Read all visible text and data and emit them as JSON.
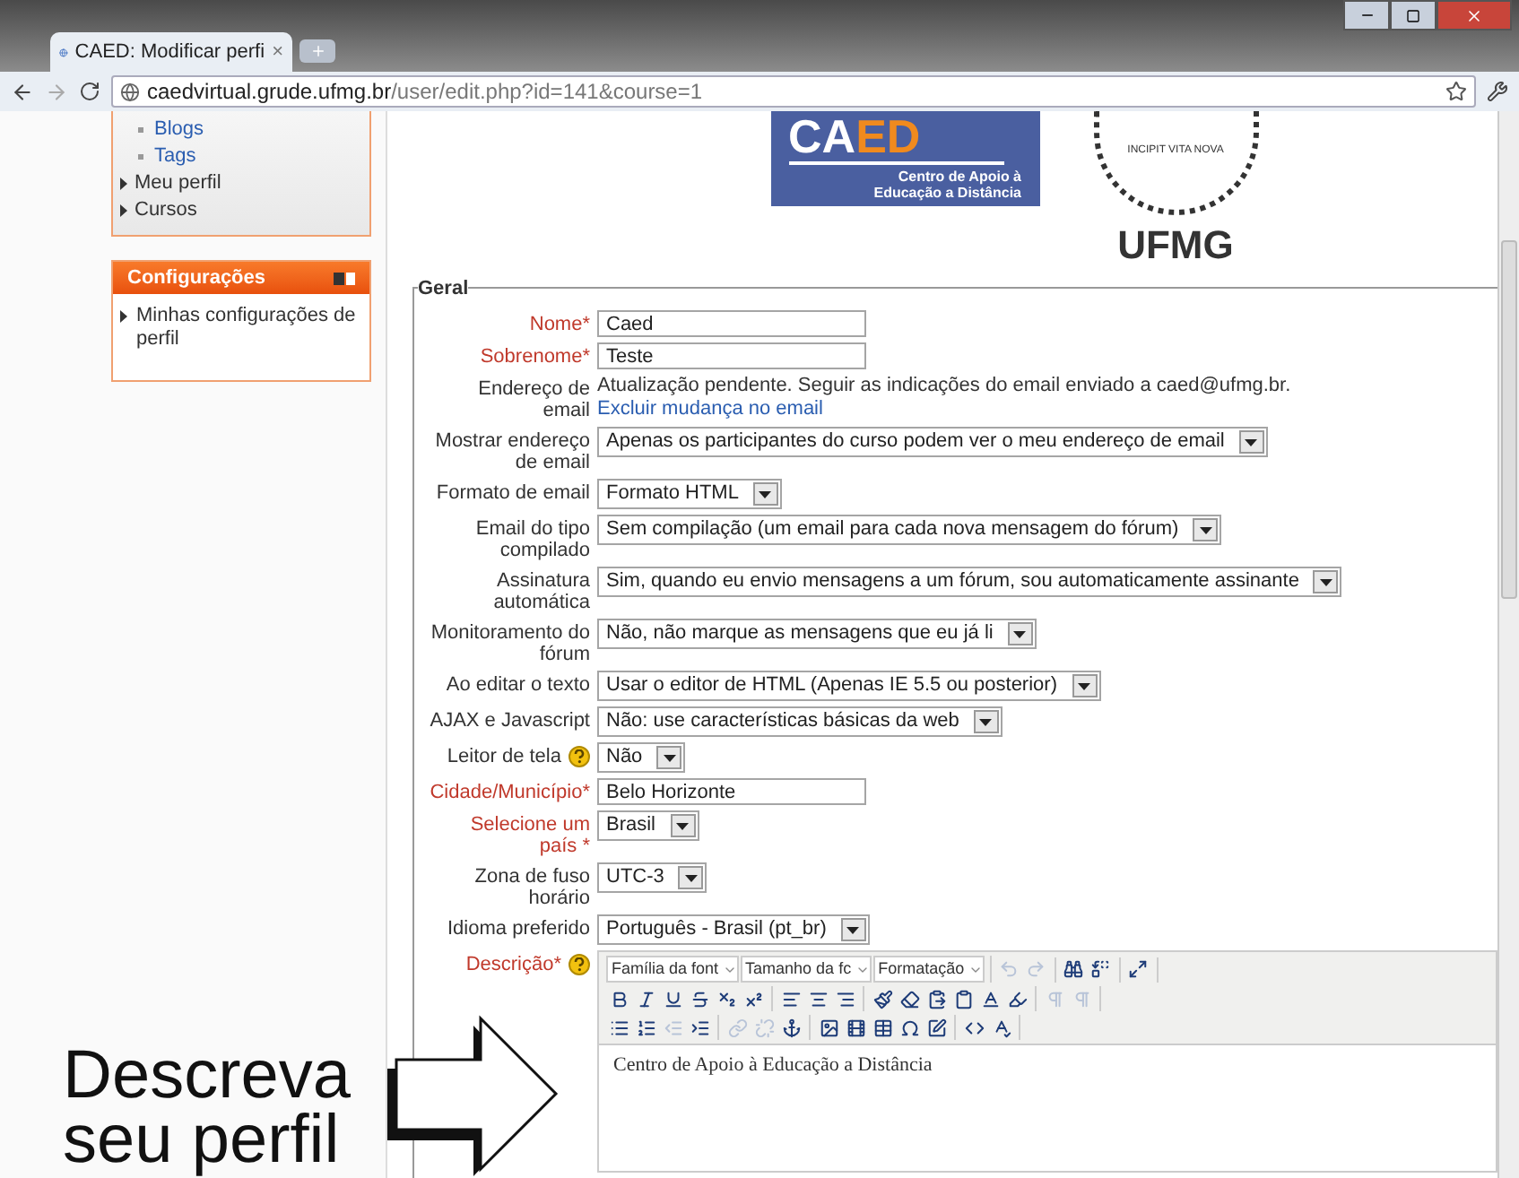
{
  "browser": {
    "tab_title": "CAED: Modificar perfi",
    "tab_close": "×",
    "address_host": "caedvirtual.grude.ufmg.br",
    "address_path": "/user/edit.php?id=141&course=1"
  },
  "sidebar": {
    "nav_items": [
      {
        "label": "Blogs",
        "kind": "sub"
      },
      {
        "label": "Tags",
        "kind": "sub"
      },
      {
        "label": "Meu perfil",
        "kind": "branch"
      },
      {
        "label": "Cursos",
        "kind": "branch"
      }
    ],
    "settings_block": {
      "title": "Configurações",
      "items": [
        "Minhas configurações de perfil"
      ]
    }
  },
  "header": {
    "caed": {
      "acronym_start": "CA",
      "acronym_end": "ED",
      "subtitle": [
        "Centro de Apoio à",
        "Educação a Distância"
      ]
    },
    "ufmg": {
      "motto": "INCIPIT VITA NOVA",
      "name": "UFMG"
    }
  },
  "form": {
    "legend": "Geral",
    "fields": [
      {
        "kind": "text",
        "label": "Nome*",
        "required": true,
        "help": false,
        "value": "Caed"
      },
      {
        "kind": "text",
        "label": "Sobrenome*",
        "required": true,
        "help": false,
        "value": "Teste"
      },
      {
        "kind": "static",
        "label": "Endereço de email",
        "required": false,
        "help": false,
        "value": "Atualização pendente. Seguir as indicações do email enviado a caed@ufmg.br.",
        "link": "Excluir mudança no email"
      },
      {
        "kind": "select",
        "label": "Mostrar endereço de email",
        "required": false,
        "help": false,
        "value": "Apenas os participantes do curso podem ver o meu endereço de email"
      },
      {
        "kind": "select",
        "label": "Formato de email",
        "required": false,
        "help": false,
        "value": "Formato HTML"
      },
      {
        "kind": "select",
        "label": "Email do tipo compilado",
        "required": false,
        "help": false,
        "value": "Sem compilação (um email para cada nova mensagem do fórum)"
      },
      {
        "kind": "select",
        "label": "Assinatura automática",
        "required": false,
        "help": false,
        "value": "Sim, quando eu envio mensagens a um fórum, sou automaticamente assinante"
      },
      {
        "kind": "select",
        "label": "Monitoramento do fórum",
        "required": false,
        "help": false,
        "value": "Não, não marque as mensagens que eu já li"
      },
      {
        "kind": "select",
        "label": "Ao editar o texto",
        "required": false,
        "help": false,
        "value": "Usar o editor de HTML (Apenas IE 5.5 ou posterior)"
      },
      {
        "kind": "select",
        "label": "AJAX e Javascript",
        "required": false,
        "help": false,
        "value": "Não: use características básicas da web"
      },
      {
        "kind": "select",
        "label": "Leitor de tela",
        "required": false,
        "help": true,
        "value": "Não"
      },
      {
        "kind": "text",
        "label": "Cidade/Município*",
        "required": true,
        "help": false,
        "value": "Belo Horizonte"
      },
      {
        "kind": "select",
        "label": "Selecione um país *",
        "required": true,
        "help": false,
        "value": "Brasil"
      },
      {
        "kind": "select",
        "label": "Zona de fuso horário",
        "required": false,
        "help": false,
        "value": "UTC-3"
      },
      {
        "kind": "select",
        "label": "Idioma preferido",
        "required": false,
        "help": false,
        "value": "Português - Brasil (pt_br)"
      },
      {
        "kind": "editor",
        "label": "Descrição*",
        "required": true,
        "help": true,
        "value": "Centro de Apoio à Educação a Distância"
      }
    ],
    "toolbar_rows": [
      [
        [
          {
            "kind": "dropdown",
            "label": "Família da font"
          },
          {
            "kind": "dropdown",
            "label": "Tamanho da fc"
          },
          {
            "kind": "dropdown",
            "label": "Formatação"
          }
        ],
        [
          {
            "kind": "button",
            "disabled": true
          },
          {
            "kind": "button",
            "disabled": true
          }
        ],
        [
          {
            "kind": "button",
            "disabled": false
          },
          {
            "kind": "button",
            "disabled": false
          }
        ],
        [
          {
            "kind": "button",
            "disabled": false
          }
        ]
      ],
      [
        [
          {
            "kind": "button",
            "disabled": false
          },
          {
            "kind": "button",
            "disabled": false
          },
          {
            "kind": "button",
            "disabled": false
          },
          {
            "kind": "button",
            "disabled": false
          },
          {
            "kind": "button",
            "disabled": false
          },
          {
            "kind": "button",
            "disabled": false
          }
        ],
        [
          {
            "kind": "button",
            "disabled": false
          },
          {
            "kind": "button",
            "disabled": false
          },
          {
            "kind": "button",
            "disabled": false
          }
        ],
        [
          {
            "kind": "button",
            "disabled": false
          },
          {
            "kind": "button",
            "disabled": false
          },
          {
            "kind": "button",
            "disabled": false
          },
          {
            "kind": "button",
            "disabled": false
          },
          {
            "kind": "button",
            "disabled": false
          },
          {
            "kind": "button",
            "disabled": false
          }
        ],
        [
          {
            "kind": "button",
            "disabled": true
          },
          {
            "kind": "button",
            "disabled": true
          }
        ]
      ],
      [
        [
          {
            "kind": "button",
            "disabled": false
          },
          {
            "kind": "button",
            "disabled": false
          },
          {
            "kind": "button",
            "disabled": true
          },
          {
            "kind": "button",
            "disabled": false
          }
        ],
        [
          {
            "kind": "button",
            "disabled": true
          },
          {
            "kind": "button",
            "disabled": true
          },
          {
            "kind": "button",
            "disabled": false
          }
        ],
        [
          {
            "kind": "button",
            "disabled": false
          },
          {
            "kind": "button",
            "disabled": false
          },
          {
            "kind": "button",
            "disabled": false
          },
          {
            "kind": "button",
            "disabled": false
          },
          {
            "kind": "button",
            "disabled": false
          }
        ],
        [
          {
            "kind": "button",
            "disabled": false
          },
          {
            "kind": "button",
            "disabled": false
          }
        ]
      ]
    ]
  },
  "annotation": {
    "lines": [
      "Descreva",
      "seu perfil"
    ]
  }
}
